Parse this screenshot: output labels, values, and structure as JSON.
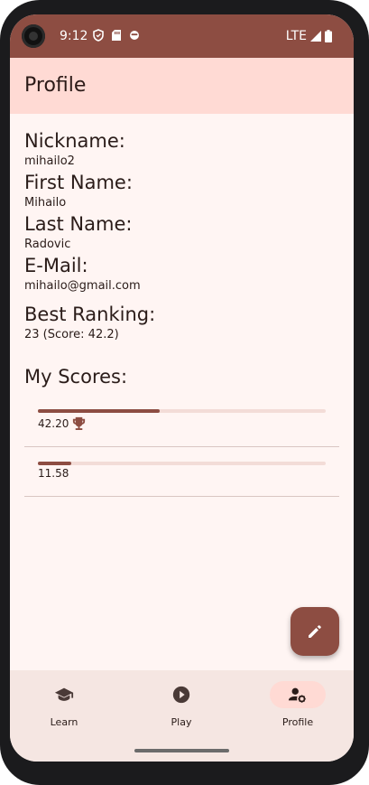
{
  "status_bar": {
    "time": "9:12",
    "network": "LTE"
  },
  "app_bar": {
    "title": "Profile"
  },
  "profile": {
    "nickname_label": "Nickname:",
    "nickname": "mihailo2",
    "first_name_label": "First Name:",
    "first_name": "Mihailo",
    "last_name_label": "Last Name:",
    "last_name": "Radovic",
    "email_label": "E-Mail:",
    "email": "mihailo@gmail.com",
    "best_ranking_label": "Best Ranking:",
    "best_ranking": "23 (Score: 42.2)"
  },
  "scores": {
    "title": "My Scores:",
    "items": [
      {
        "value": "42.20",
        "progress": 0.422,
        "icon": "trophy-icon"
      },
      {
        "value": "11.58",
        "progress": 0.1158,
        "icon": ""
      }
    ]
  },
  "fab": {
    "icon": "edit-icon"
  },
  "bottom_nav": {
    "items": [
      {
        "label": "Learn",
        "icon": "school-icon",
        "active": false
      },
      {
        "label": "Play",
        "icon": "play-circle-icon",
        "active": false
      },
      {
        "label": "Profile",
        "icon": "manage-accounts-icon",
        "active": true
      }
    ]
  },
  "colors": {
    "primary": "#8d4d42",
    "app_bar": "#ffdad4",
    "background": "#fff5f3",
    "nav_background": "#f5e6e2"
  }
}
